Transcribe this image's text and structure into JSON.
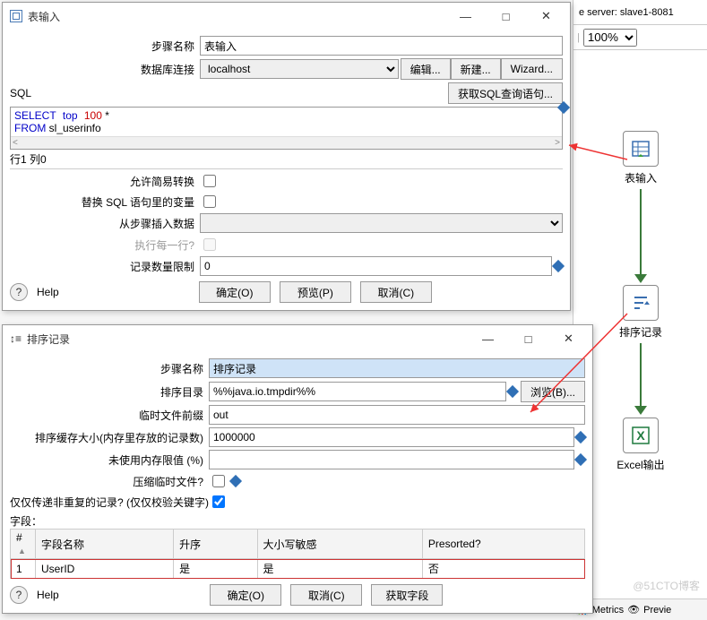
{
  "dialog1": {
    "title": "表输入",
    "labels": {
      "step_name": "步骤名称",
      "db_conn": "数据库连接",
      "sql": "SQL",
      "get_sql": "获取SQL查询语句...",
      "edit": "编辑...",
      "new": "新建...",
      "wizard": "Wizard...",
      "row_col": "行1 列0",
      "allow_lazy": "允许简易转换",
      "replace_vars": "替换 SQL 语句里的变量",
      "insert_from": "从步骤插入数据",
      "each_row": "执行每一行?",
      "limit": "记录数量限制",
      "ok": "确定(O)",
      "preview": "预览(P)",
      "cancel": "取消(C)",
      "help": "Help"
    },
    "values": {
      "step_name": "表输入",
      "db_conn": "localhost",
      "sql_kw1": "SELECT",
      "sql_kw2": "top",
      "sql_num": "100",
      "sql_rest1": " *",
      "sql_kw3": "FROM",
      "sql_rest2": " sl_userinfo",
      "limit": "0"
    }
  },
  "dialog2": {
    "title": "排序记录",
    "labels": {
      "step_name": "步骤名称",
      "sort_dir": "排序目录",
      "browse": "浏览(B)...",
      "tmp_prefix": "临时文件前缀",
      "buffer_size": "排序缓存大小(内存里存放的记录数)",
      "mem_threshold": "未使用内存限值 (%)",
      "compress": "压缩临时文件?",
      "unique": "仅仅传递非重复的记录? (仅仅校验关键字)",
      "fields": "字段：",
      "ok": "确定(O)",
      "cancel": "取消(C)",
      "get_fields": "获取字段",
      "help": "Help"
    },
    "columns": {
      "idx": "#",
      "name": "字段名称",
      "asc": "升序",
      "case": "大小写敏感",
      "presorted": "Presorted?"
    },
    "values": {
      "step_name": "排序记录",
      "sort_dir": "%%java.io.tmpdir%%",
      "tmp_prefix": "out",
      "buffer_size": "1000000",
      "mem_threshold": ""
    },
    "rows": [
      {
        "idx": "1",
        "name": "UserID",
        "asc": "是",
        "case": "是",
        "presorted": "否"
      }
    ]
  },
  "right": {
    "server_label": "e server: slave1-8081",
    "zoom": "100%",
    "nodes": {
      "n1": "表输入",
      "n2": "排序记录",
      "n3": "Excel输出"
    },
    "tabs": {
      "metrics": "Metrics",
      "preview": "Previe"
    }
  },
  "watermark": "@51CTO博客"
}
